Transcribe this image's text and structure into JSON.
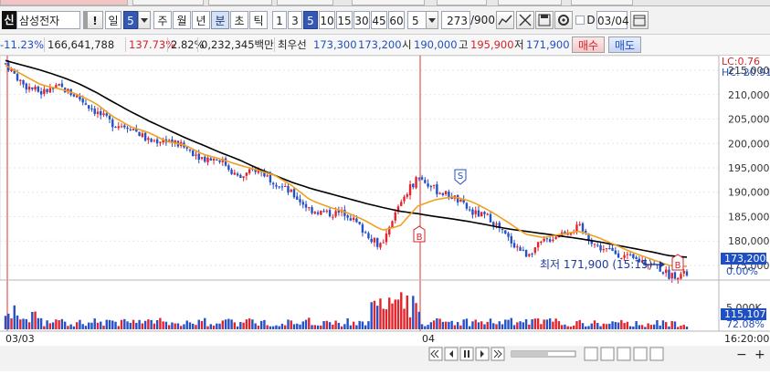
{
  "toolbar": {
    "stock_badge": "신",
    "stock_name": "삼성전자",
    "exclaim": "!",
    "period_label": "일",
    "period_value": "5",
    "periods": [
      "주",
      "월",
      "년",
      "분",
      "초",
      "틱"
    ],
    "minute_options": [
      "1",
      "3",
      "5",
      "10",
      "15",
      "30",
      "45",
      "60"
    ],
    "interval_value": "5",
    "count_value": "273",
    "count_total": "/900",
    "date_value": "03/04"
  },
  "quote": {
    "change_pct": "-11.23%",
    "volume": "166,641,788",
    "vol_ratio": "137.73%",
    "turnover_pct": "2.82%",
    "trade_value": "0,232,345백만",
    "priority_label": "최우선",
    "ask": "173,300",
    "bid": "173,200",
    "open_label": "시",
    "open": "190,000",
    "high_label": "고",
    "high": "195,900",
    "low_label": "저",
    "low": "171,900",
    "buy_button": "매수",
    "sell_button": "매도"
  },
  "chart": {
    "lc_label": "LC:0.76",
    "hc_label": "HC:-20.91",
    "price_ticks": [
      "215,000",
      "210,000",
      "205,000",
      "200,000",
      "195,000",
      "190,000",
      "185,000",
      "180,000",
      "175,000"
    ],
    "current_price": "173,200",
    "current_pct": "0.00%",
    "low_annotation": "최저 171,900 (15:15)",
    "marker_s": "S",
    "marker_b1": "B",
    "marker_b2": "B",
    "volume_tick": "5,000K",
    "volume_current": "115,107",
    "volume_pct": "72.08%",
    "date_labels": [
      "03/03",
      "04"
    ],
    "time_label": "16:20:00",
    "colors": {
      "up": "#e3242b",
      "down": "#2450c8",
      "ma_short": "#f0a020",
      "ma_long": "#000000"
    }
  },
  "chart_data": {
    "type": "candlestick",
    "x": [
      "03/03",
      "04"
    ],
    "price_range": [
      172000,
      218000
    ],
    "series": [
      {
        "values": [
          216400,
          212000,
          210400,
          211600,
          209600,
          206600,
          204000,
          203400,
          200400,
          200800,
          199200,
          197000,
          196800,
          192800,
          194800,
          192200,
          189600,
          186400,
          185600,
          185800,
          182000,
          178600,
          188000,
          193200,
          190400,
          189000,
          185800,
          184800,
          180600,
          177200,
          179800,
          181600,
          182800,
          178800,
          177600,
          176200,
          175600,
          173000,
          173200
        ]
      },
      {
        "values": [
          217000,
          216000,
          215000,
          213800,
          212400,
          210600,
          208500,
          206500,
          204600,
          202900,
          201200,
          199700,
          198100,
          196700,
          195000,
          193500,
          192000,
          190800,
          189800,
          188800,
          187800,
          186900,
          186100,
          185600,
          185000,
          184500,
          183900,
          183200,
          182500,
          182000,
          181500,
          181000,
          180500,
          179900,
          179200,
          178500,
          177800,
          177000,
          176700
        ]
      },
      {
        "values": [
          216000,
          214000,
          212000,
          211200,
          210100,
          208300,
          205500,
          203400,
          202200,
          200400,
          199700,
          197800,
          196800,
          195600,
          194600,
          193500,
          191300,
          188400,
          187000,
          185900,
          184300,
          182200,
          183100,
          187200,
          188500,
          189100,
          188100,
          186200,
          183900,
          181400,
          180700,
          181400,
          182000,
          180800,
          179200,
          177600,
          176300,
          175000,
          174800
        ]
      }
    ],
    "volume": {
      "ylim": [
        0,
        6000
      ]
    }
  }
}
